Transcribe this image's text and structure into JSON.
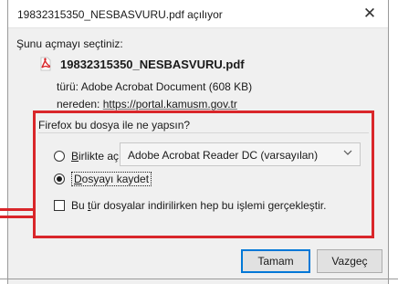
{
  "window": {
    "title": "19832315350_NESBASVURU.pdf açılıyor",
    "close_glyph": "✕"
  },
  "dialog": {
    "choose_label": "Şunu açmayı seçtiniz:",
    "file_name": "19832315350_NESBASVURU.pdf",
    "file_icon": "pdf-icon",
    "type_prefix": "türü:",
    "type_value": "Adobe Acrobat Document (608 KB)",
    "from_prefix": "nereden:",
    "from_value": "https://portal.kamusm.gov.tr"
  },
  "action": {
    "question": "Firefox bu dosya ile ne yapsın?",
    "open_with_label_first": "B",
    "open_with_label_rest": "irlikte aç",
    "open_with_app": "Adobe Acrobat Reader DC  (varsayılan)",
    "save_label_first": "D",
    "save_label_rest": "osyayı kaydet",
    "selected": "save",
    "remember_pre": "Bu ",
    "remember_u": "t",
    "remember_post": "ür dosyalar indirilirken hep bu işlemi gerçekleştir.",
    "remember_checked": false
  },
  "buttons": {
    "ok": "Tamam",
    "cancel": "Vazgeç"
  },
  "colors": {
    "highlight": "#d9262a",
    "default_button_border": "#0078d7",
    "pdf_icon": "#d9262a"
  }
}
